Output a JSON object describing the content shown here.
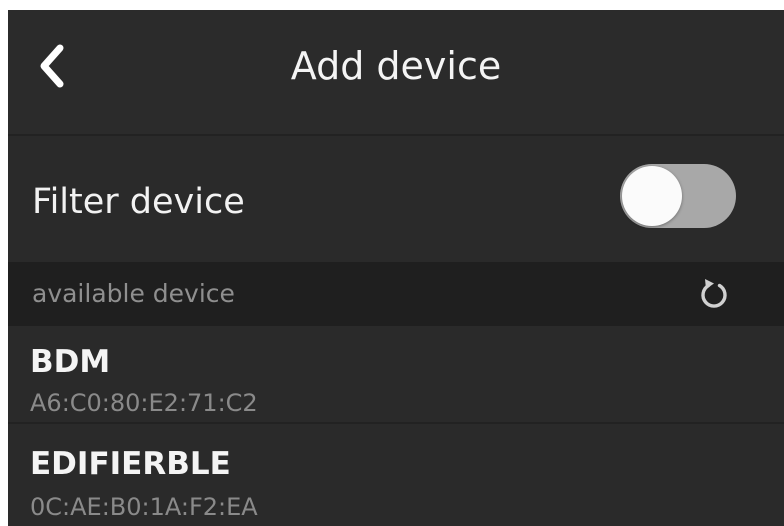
{
  "header": {
    "title": "Add device",
    "back_icon": "chevron-left-icon"
  },
  "filter": {
    "label": "Filter device",
    "toggle_on": false
  },
  "section": {
    "label": "available device",
    "refresh_icon": "refresh-icon"
  },
  "devices": [
    {
      "name": "BDM",
      "mac": "A6:C0:80:E2:71:C2"
    },
    {
      "name": "EDIFIERBLE",
      "mac": "0C:AE:B0:1A:F2:EA"
    }
  ],
  "colors": {
    "background": "#2a2a2a",
    "section_background": "#1f1f1f",
    "text_primary": "#f4f4f4",
    "text_secondary": "#8a8a8a",
    "toggle_track_off": "#a8a8a8",
    "toggle_knob": "#fbfbfb"
  }
}
